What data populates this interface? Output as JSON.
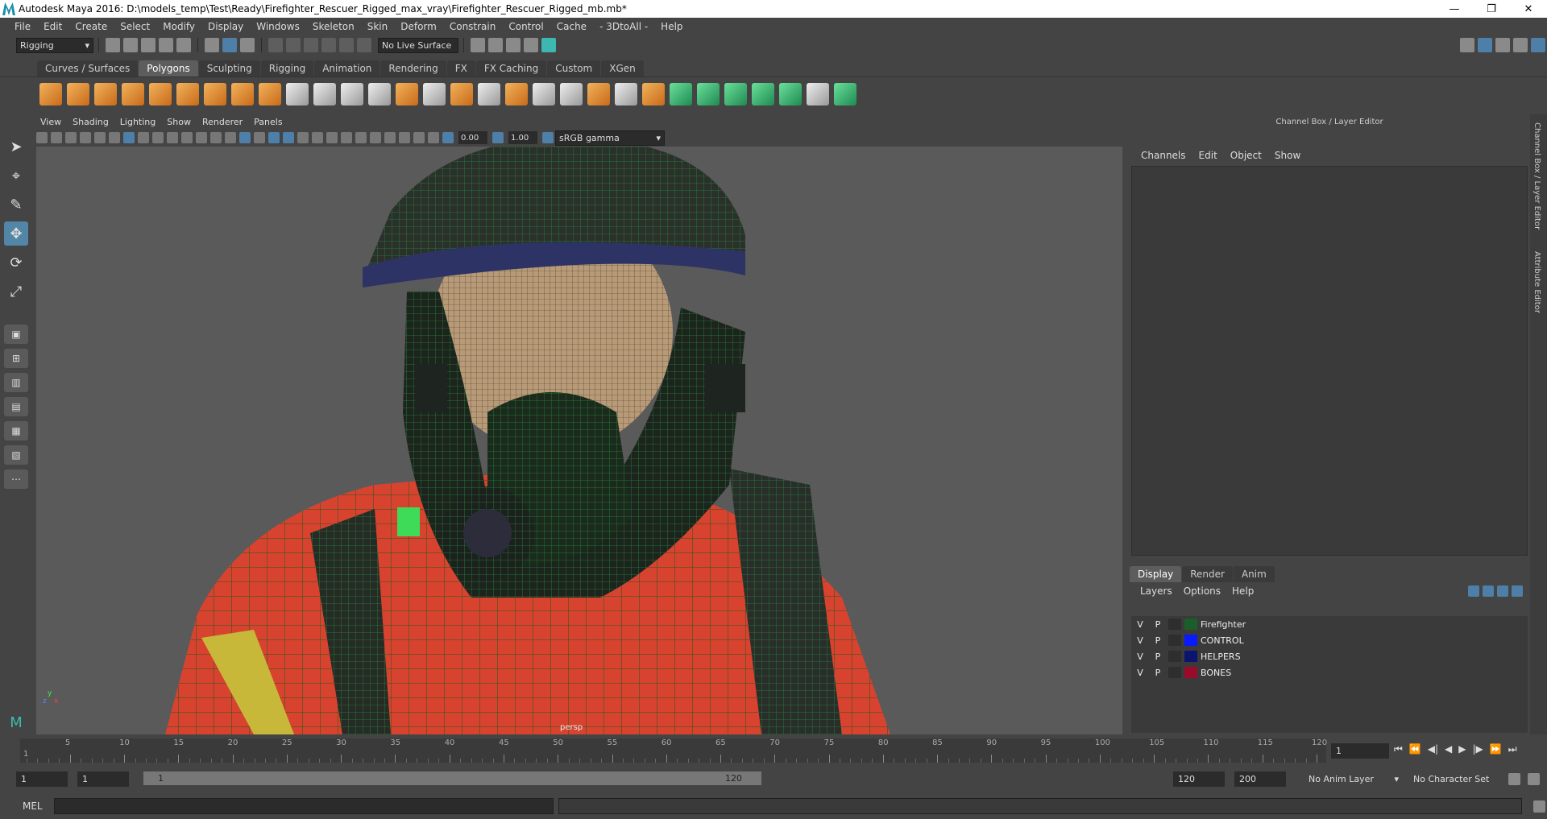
{
  "window": {
    "title": "Autodesk Maya 2016: D:\\models_temp\\Test\\Ready\\Firefighter_Rescuer_Rigged_max_vray\\Firefighter_Rescuer_Rigged_mb.mb*",
    "minimize": "—",
    "maximize": "❐",
    "close": "✕"
  },
  "menubar": [
    "File",
    "Edit",
    "Create",
    "Select",
    "Modify",
    "Display",
    "Windows",
    "Skeleton",
    "Skin",
    "Deform",
    "Constrain",
    "Control",
    "Cache",
    "- 3DtoAll -",
    "Help"
  ],
  "statusline": {
    "menu_set": "Rigging",
    "live_surface": "No Live Surface"
  },
  "shelf_tabs": [
    "Curves / Surfaces",
    "Polygons",
    "Sculpting",
    "Rigging",
    "Animation",
    "Rendering",
    "FX",
    "FX Caching",
    "Custom",
    "XGen"
  ],
  "shelf_active": "Polygons",
  "viewport": {
    "menu": [
      "View",
      "Shading",
      "Lighting",
      "Show",
      "Renderer",
      "Panels"
    ],
    "exposure": "0.00",
    "gamma": "1.00",
    "color_space": "sRGB gamma",
    "camera_label": "persp",
    "axis_x": "x",
    "axis_y": "y",
    "axis_z": "z"
  },
  "channel_box": {
    "header": "Channel Box / Layer Editor",
    "menu": [
      "Channels",
      "Edit",
      "Object",
      "Show"
    ]
  },
  "side_tabs": [
    "Channel Box / Layer Editor",
    "Attribute Editor"
  ],
  "layer_editor": {
    "tabs": [
      "Display",
      "Render",
      "Anim"
    ],
    "active_tab": "Display",
    "menu": [
      "Layers",
      "Options",
      "Help"
    ],
    "layers": [
      {
        "v": "V",
        "p": "P",
        "name": "Firefighter",
        "color": "#1b5e2a"
      },
      {
        "v": "V",
        "p": "P",
        "name": "CONTROL",
        "color": "#0a1aff"
      },
      {
        "v": "V",
        "p": "P",
        "name": "HELPERS",
        "color": "#0c1470"
      },
      {
        "v": "V",
        "p": "P",
        "name": "BONES",
        "color": "#9a0a2a"
      }
    ]
  },
  "timeline": {
    "start": 1,
    "end": 120,
    "ticks": [
      "5",
      "10",
      "15",
      "20",
      "25",
      "30",
      "35",
      "40",
      "45",
      "50",
      "55",
      "60",
      "65",
      "70",
      "75",
      "80",
      "85",
      "90",
      "95",
      "100",
      "105",
      "110",
      "115",
      "120"
    ],
    "first_tick": "1",
    "current_frame": "1"
  },
  "range": {
    "start_field": "1",
    "playback_start": "1",
    "bar_start": "1",
    "bar_end": "120",
    "playback_end": "120",
    "end_field": "200",
    "anim_layer": "No Anim Layer",
    "character_set": "No Character Set"
  },
  "command_line": {
    "label": "MEL"
  }
}
